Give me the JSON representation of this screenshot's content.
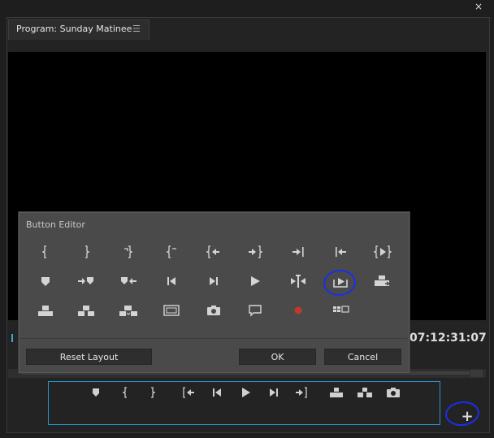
{
  "window": {
    "close_glyph": "×"
  },
  "panel": {
    "tab_title": "Program: Sunday Matinee",
    "tab_menu_glyph": "☰"
  },
  "monitor": {
    "timecode": "07:12:31:07"
  },
  "dialog": {
    "title": "Button Editor",
    "buttons": {
      "reset": "Reset Layout",
      "ok": "OK",
      "cancel": "Cancel"
    },
    "icons_row1": [
      "mark-in-icon",
      "mark-out-icon",
      "mark-clip-icon",
      "go-to-in-icon",
      "go-to-in-edit-icon",
      "go-to-out-edit-icon",
      "go-to-next-edit-icon",
      "go-to-prev-edit-icon",
      "play-in-to-out-icon"
    ],
    "icons_row2": [
      "add-marker-icon",
      "go-to-next-marker-icon",
      "go-to-prev-marker-icon",
      "step-back-icon",
      "step-forward-icon",
      "play-icon",
      "trim-icon",
      "export-frame-highlighted-icon",
      "overwrite-icon"
    ],
    "icons_row3": [
      "lift-icon",
      "extract-icon",
      "insert-icon",
      "safe-margins-icon",
      "camera-icon",
      "comment-icon",
      "record-icon",
      "multi-camera-icon"
    ]
  },
  "transport": {
    "icons": [
      "add-marker-icon",
      "mark-in-icon",
      "mark-out-icon",
      "go-to-in-icon",
      "step-back-icon",
      "play-icon",
      "step-forward-icon",
      "go-to-out-icon",
      "lift-icon",
      "extract-icon",
      "export-frame-icon"
    ]
  },
  "add_button": {
    "glyph": "+"
  },
  "colors": {
    "accent_blue": "#2b94c9",
    "annotation": "#1a2fe8",
    "record_red": "#c0392b"
  }
}
